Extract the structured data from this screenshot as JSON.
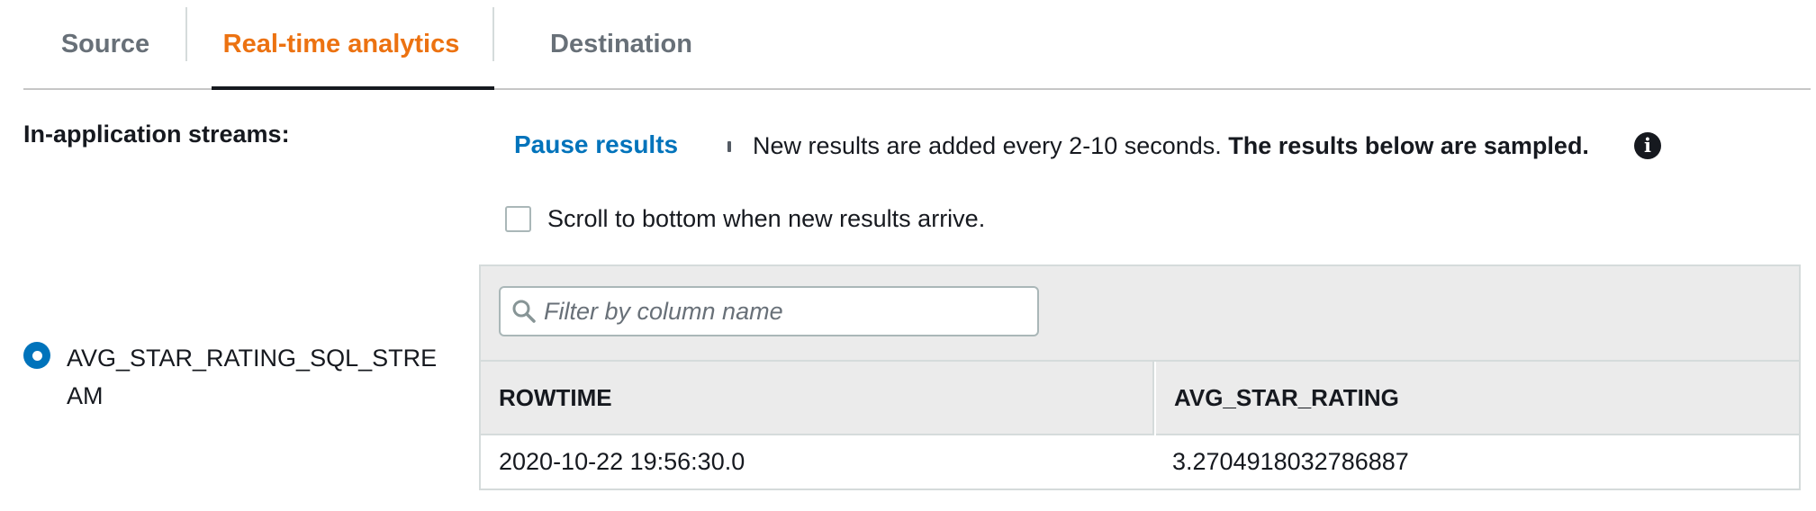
{
  "tabs": [
    {
      "label": "Source"
    },
    {
      "label": "Real-time analytics",
      "active": true
    },
    {
      "label": "Destination"
    }
  ],
  "streams": {
    "label": "In-application streams:",
    "selected": "AVG_STAR_RATING_SQL_STREAM"
  },
  "controls": {
    "pause_label": "Pause results",
    "info_text": "New results are added every 2-10 seconds.",
    "info_bold": "The results below are sampled.",
    "info_icon": "info-icon",
    "scroll_checkbox_label": "Scroll to bottom when new results arrive.",
    "scroll_checked": false
  },
  "results": {
    "filter_placeholder": "Filter by column name",
    "columns": [
      "ROWTIME",
      "AVG_STAR_RATING"
    ],
    "rows": [
      [
        "2020-10-22 19:56:30.0",
        "3.2704918032786887"
      ]
    ]
  },
  "colors": {
    "active_tab": "#ec7211",
    "link": "#0073bb",
    "radio": "#0073bb"
  }
}
